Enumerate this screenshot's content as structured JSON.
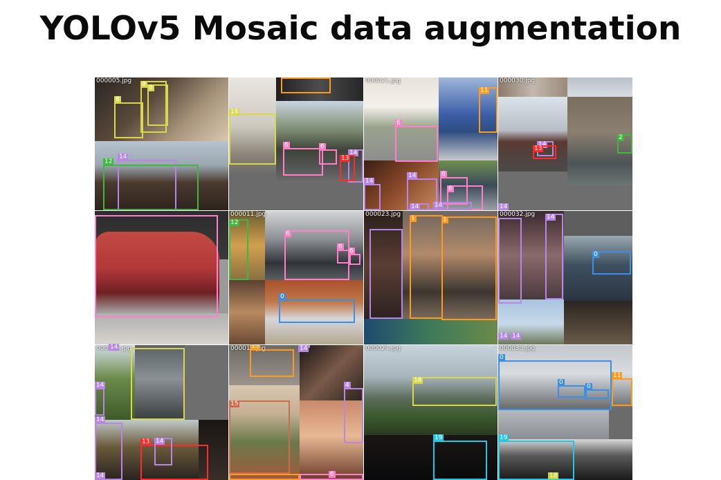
{
  "title": "YOLOv5 Mosaic data augmentation",
  "tiles": [
    {
      "file": "000005.jpg",
      "labels": [
        "8",
        "8",
        "8",
        "14",
        "12"
      ]
    },
    {
      "file": "",
      "labels": [
        "18",
        "6",
        "6",
        "14",
        "13"
      ]
    },
    {
      "file": "000021.jpg",
      "labels": [
        "11",
        "6",
        "14",
        "14",
        "6",
        "6",
        "14",
        "14"
      ]
    },
    {
      "file": "000030.jpg",
      "labels": [
        "14",
        "13",
        "2",
        "14"
      ]
    },
    {
      "file": "",
      "labels": []
    },
    {
      "file": "000011.jpg",
      "labels": [
        "12",
        "6",
        "6",
        "6",
        "0"
      ]
    },
    {
      "file": "000023.jpg",
      "labels": [
        "1",
        "1"
      ]
    },
    {
      "file": "000032.jpg",
      "labels": [
        "14",
        "0",
        "14",
        "14"
      ]
    },
    {
      "file": "000009.jpg",
      "labels": [
        "14",
        "14",
        "13",
        "14",
        "14"
      ]
    },
    {
      "file": "000019.jpg",
      "labels": [
        "15",
        "14",
        "15",
        "4",
        "6"
      ]
    },
    {
      "file": "000024.jpg",
      "labels": [
        "18",
        "19"
      ]
    },
    {
      "file": "000033.jpg",
      "labels": [
        "0",
        "0",
        "0",
        "11",
        "19",
        "18"
      ]
    }
  ],
  "extra_labels": [
    "14",
    "14"
  ],
  "colors": {
    "yellow": "#d8d84a",
    "purple": "#b986e6",
    "green": "#3fb83f",
    "orange": "#ff9a1f",
    "pink": "#ff80c8",
    "red": "#ff2a2a",
    "blue": "#3a8fe6",
    "cyan": "#22c8e6",
    "olive": "#c8d23c"
  }
}
